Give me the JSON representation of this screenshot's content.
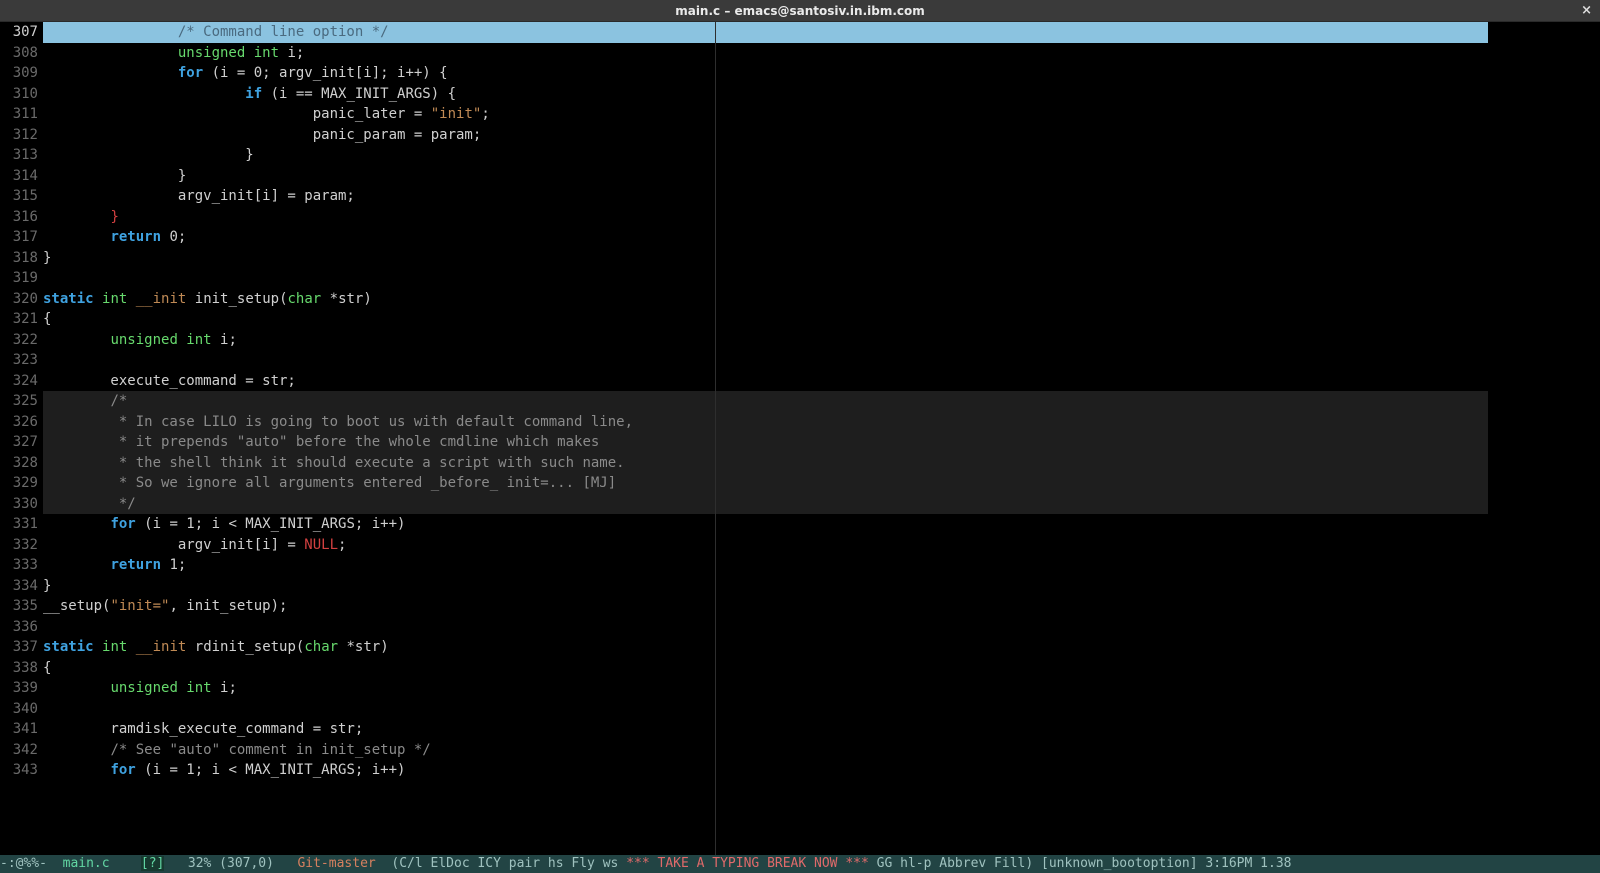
{
  "titlebar": {
    "title": "main.c – emacs@santosiv.in.ibm.com",
    "close_glyph": "×"
  },
  "gutter_start": 307,
  "current_line_index": 0,
  "highlight_ranges": [
    [
      18,
      23
    ],
    [
      40,
      41
    ]
  ],
  "code_lines": [
    [
      [
        "comment",
        "                /* Command line option */"
      ]
    ],
    [
      [
        "plain",
        "                "
      ],
      [
        "type",
        "unsigned int"
      ],
      [
        "plain",
        " i;"
      ]
    ],
    [
      [
        "plain",
        "                "
      ],
      [
        "kw",
        "for"
      ],
      [
        "plain",
        " (i = 0; argv_init[i]; i++) {"
      ]
    ],
    [
      [
        "plain",
        "                        "
      ],
      [
        "kw",
        "if"
      ],
      [
        "plain",
        " (i == MAX_INIT_ARGS) {"
      ]
    ],
    [
      [
        "plain",
        "                                panic_later = "
      ],
      [
        "string",
        "\"init\""
      ],
      [
        "plain",
        ";"
      ]
    ],
    [
      [
        "plain",
        "                                panic_param = param;"
      ]
    ],
    [
      [
        "plain",
        "                        }"
      ]
    ],
    [
      [
        "plain",
        "                }"
      ]
    ],
    [
      [
        "plain",
        "                argv_init[i] = param;"
      ]
    ],
    [
      [
        "plain",
        "        "
      ],
      [
        "warn",
        "}"
      ]
    ],
    [
      [
        "plain",
        "        "
      ],
      [
        "kw",
        "return"
      ],
      [
        "plain",
        " 0;"
      ]
    ],
    [
      [
        "plain",
        "}"
      ]
    ],
    [
      [
        "plain",
        ""
      ]
    ],
    [
      [
        "kw",
        "static"
      ],
      [
        "plain",
        " "
      ],
      [
        "type",
        "int"
      ],
      [
        "plain",
        " "
      ],
      [
        "attr",
        "__init"
      ],
      [
        "plain",
        " "
      ],
      [
        "ident",
        "init_setup"
      ],
      [
        "plain",
        "("
      ],
      [
        "type",
        "char"
      ],
      [
        "plain",
        " *str)"
      ]
    ],
    [
      [
        "plain",
        "{"
      ]
    ],
    [
      [
        "plain",
        "        "
      ],
      [
        "type",
        "unsigned int"
      ],
      [
        "plain",
        " i;"
      ]
    ],
    [
      [
        "plain",
        ""
      ]
    ],
    [
      [
        "plain",
        "        execute_command = str;"
      ]
    ],
    [
      [
        "plain",
        "        "
      ],
      [
        "comment",
        "/*"
      ]
    ],
    [
      [
        "comment",
        "         * In case LILO is going to boot us with default command line,"
      ]
    ],
    [
      [
        "comment",
        "         * it prepends \"auto\" before the whole cmdline which makes"
      ]
    ],
    [
      [
        "comment",
        "         * the shell think it should execute a script with such name."
      ]
    ],
    [
      [
        "comment",
        "         * So we ignore all arguments entered _before_ init=... [MJ]"
      ]
    ],
    [
      [
        "comment",
        "         */"
      ]
    ],
    [
      [
        "plain",
        "        "
      ],
      [
        "kw",
        "for"
      ],
      [
        "plain",
        " (i = 1; i < MAX_INIT_ARGS; i++)"
      ]
    ],
    [
      [
        "plain",
        "                argv_init[i] = "
      ],
      [
        "null",
        "NULL"
      ],
      [
        "plain",
        ";"
      ]
    ],
    [
      [
        "plain",
        "        "
      ],
      [
        "kw",
        "return"
      ],
      [
        "plain",
        " 1;"
      ]
    ],
    [
      [
        "plain",
        "}"
      ]
    ],
    [
      [
        "plain",
        "__setup("
      ],
      [
        "string",
        "\"init=\""
      ],
      [
        "plain",
        ", init_setup);"
      ]
    ],
    [
      [
        "plain",
        ""
      ]
    ],
    [
      [
        "kw",
        "static"
      ],
      [
        "plain",
        " "
      ],
      [
        "type",
        "int"
      ],
      [
        "plain",
        " "
      ],
      [
        "attr",
        "__init"
      ],
      [
        "plain",
        " "
      ],
      [
        "ident",
        "rdinit_setup"
      ],
      [
        "plain",
        "("
      ],
      [
        "type",
        "char"
      ],
      [
        "plain",
        " *str)"
      ]
    ],
    [
      [
        "plain",
        "{"
      ]
    ],
    [
      [
        "plain",
        "        "
      ],
      [
        "type",
        "unsigned int"
      ],
      [
        "plain",
        " i;"
      ]
    ],
    [
      [
        "plain",
        ""
      ]
    ],
    [
      [
        "plain",
        "        ramdisk_execute_command = str;"
      ]
    ],
    [
      [
        "plain",
        "        "
      ],
      [
        "comment",
        "/* See \"auto\" comment in init_setup */"
      ]
    ],
    [
      [
        "plain",
        "        "
      ],
      [
        "kw",
        "for"
      ],
      [
        "plain",
        " (i = 1; i < MAX_INIT_ARGS; i++)"
      ]
    ]
  ],
  "modeline": {
    "left": "-:@%%-  ",
    "buffer": "main.c",
    "flag": "[?]",
    "pos": "   32% (307,0)   ",
    "vcs": "Git-master",
    "modes": "  (C/l ElDoc ICY pair hs Fly ws ",
    "alert": "*** TAKE A TYPING BREAK NOW ***",
    "tail": " GG hl-p Abbrev Fill) [unknown_bootoption] 3:16PM 1.38"
  }
}
